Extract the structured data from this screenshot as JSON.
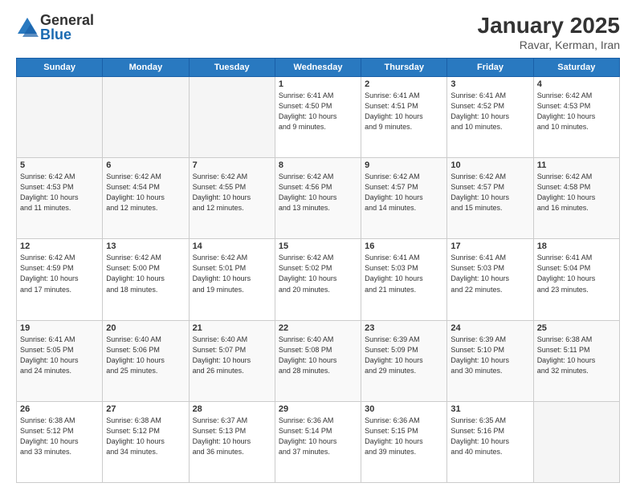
{
  "logo": {
    "general": "General",
    "blue": "Blue"
  },
  "title": "January 2025",
  "subtitle": "Ravar, Kerman, Iran",
  "days_header": [
    "Sunday",
    "Monday",
    "Tuesday",
    "Wednesday",
    "Thursday",
    "Friday",
    "Saturday"
  ],
  "weeks": [
    {
      "shade": false,
      "days": [
        {
          "num": "",
          "info": ""
        },
        {
          "num": "",
          "info": ""
        },
        {
          "num": "",
          "info": ""
        },
        {
          "num": "1",
          "info": "Sunrise: 6:41 AM\nSunset: 4:50 PM\nDaylight: 10 hours\nand 9 minutes."
        },
        {
          "num": "2",
          "info": "Sunrise: 6:41 AM\nSunset: 4:51 PM\nDaylight: 10 hours\nand 9 minutes."
        },
        {
          "num": "3",
          "info": "Sunrise: 6:41 AM\nSunset: 4:52 PM\nDaylight: 10 hours\nand 10 minutes."
        },
        {
          "num": "4",
          "info": "Sunrise: 6:42 AM\nSunset: 4:53 PM\nDaylight: 10 hours\nand 10 minutes."
        }
      ]
    },
    {
      "shade": true,
      "days": [
        {
          "num": "5",
          "info": "Sunrise: 6:42 AM\nSunset: 4:53 PM\nDaylight: 10 hours\nand 11 minutes."
        },
        {
          "num": "6",
          "info": "Sunrise: 6:42 AM\nSunset: 4:54 PM\nDaylight: 10 hours\nand 12 minutes."
        },
        {
          "num": "7",
          "info": "Sunrise: 6:42 AM\nSunset: 4:55 PM\nDaylight: 10 hours\nand 12 minutes."
        },
        {
          "num": "8",
          "info": "Sunrise: 6:42 AM\nSunset: 4:56 PM\nDaylight: 10 hours\nand 13 minutes."
        },
        {
          "num": "9",
          "info": "Sunrise: 6:42 AM\nSunset: 4:57 PM\nDaylight: 10 hours\nand 14 minutes."
        },
        {
          "num": "10",
          "info": "Sunrise: 6:42 AM\nSunset: 4:57 PM\nDaylight: 10 hours\nand 15 minutes."
        },
        {
          "num": "11",
          "info": "Sunrise: 6:42 AM\nSunset: 4:58 PM\nDaylight: 10 hours\nand 16 minutes."
        }
      ]
    },
    {
      "shade": false,
      "days": [
        {
          "num": "12",
          "info": "Sunrise: 6:42 AM\nSunset: 4:59 PM\nDaylight: 10 hours\nand 17 minutes."
        },
        {
          "num": "13",
          "info": "Sunrise: 6:42 AM\nSunset: 5:00 PM\nDaylight: 10 hours\nand 18 minutes."
        },
        {
          "num": "14",
          "info": "Sunrise: 6:42 AM\nSunset: 5:01 PM\nDaylight: 10 hours\nand 19 minutes."
        },
        {
          "num": "15",
          "info": "Sunrise: 6:42 AM\nSunset: 5:02 PM\nDaylight: 10 hours\nand 20 minutes."
        },
        {
          "num": "16",
          "info": "Sunrise: 6:41 AM\nSunset: 5:03 PM\nDaylight: 10 hours\nand 21 minutes."
        },
        {
          "num": "17",
          "info": "Sunrise: 6:41 AM\nSunset: 5:03 PM\nDaylight: 10 hours\nand 22 minutes."
        },
        {
          "num": "18",
          "info": "Sunrise: 6:41 AM\nSunset: 5:04 PM\nDaylight: 10 hours\nand 23 minutes."
        }
      ]
    },
    {
      "shade": true,
      "days": [
        {
          "num": "19",
          "info": "Sunrise: 6:41 AM\nSunset: 5:05 PM\nDaylight: 10 hours\nand 24 minutes."
        },
        {
          "num": "20",
          "info": "Sunrise: 6:40 AM\nSunset: 5:06 PM\nDaylight: 10 hours\nand 25 minutes."
        },
        {
          "num": "21",
          "info": "Sunrise: 6:40 AM\nSunset: 5:07 PM\nDaylight: 10 hours\nand 26 minutes."
        },
        {
          "num": "22",
          "info": "Sunrise: 6:40 AM\nSunset: 5:08 PM\nDaylight: 10 hours\nand 28 minutes."
        },
        {
          "num": "23",
          "info": "Sunrise: 6:39 AM\nSunset: 5:09 PM\nDaylight: 10 hours\nand 29 minutes."
        },
        {
          "num": "24",
          "info": "Sunrise: 6:39 AM\nSunset: 5:10 PM\nDaylight: 10 hours\nand 30 minutes."
        },
        {
          "num": "25",
          "info": "Sunrise: 6:38 AM\nSunset: 5:11 PM\nDaylight: 10 hours\nand 32 minutes."
        }
      ]
    },
    {
      "shade": false,
      "days": [
        {
          "num": "26",
          "info": "Sunrise: 6:38 AM\nSunset: 5:12 PM\nDaylight: 10 hours\nand 33 minutes."
        },
        {
          "num": "27",
          "info": "Sunrise: 6:38 AM\nSunset: 5:12 PM\nDaylight: 10 hours\nand 34 minutes."
        },
        {
          "num": "28",
          "info": "Sunrise: 6:37 AM\nSunset: 5:13 PM\nDaylight: 10 hours\nand 36 minutes."
        },
        {
          "num": "29",
          "info": "Sunrise: 6:36 AM\nSunset: 5:14 PM\nDaylight: 10 hours\nand 37 minutes."
        },
        {
          "num": "30",
          "info": "Sunrise: 6:36 AM\nSunset: 5:15 PM\nDaylight: 10 hours\nand 39 minutes."
        },
        {
          "num": "31",
          "info": "Sunrise: 6:35 AM\nSunset: 5:16 PM\nDaylight: 10 hours\nand 40 minutes."
        },
        {
          "num": "",
          "info": ""
        }
      ]
    }
  ]
}
